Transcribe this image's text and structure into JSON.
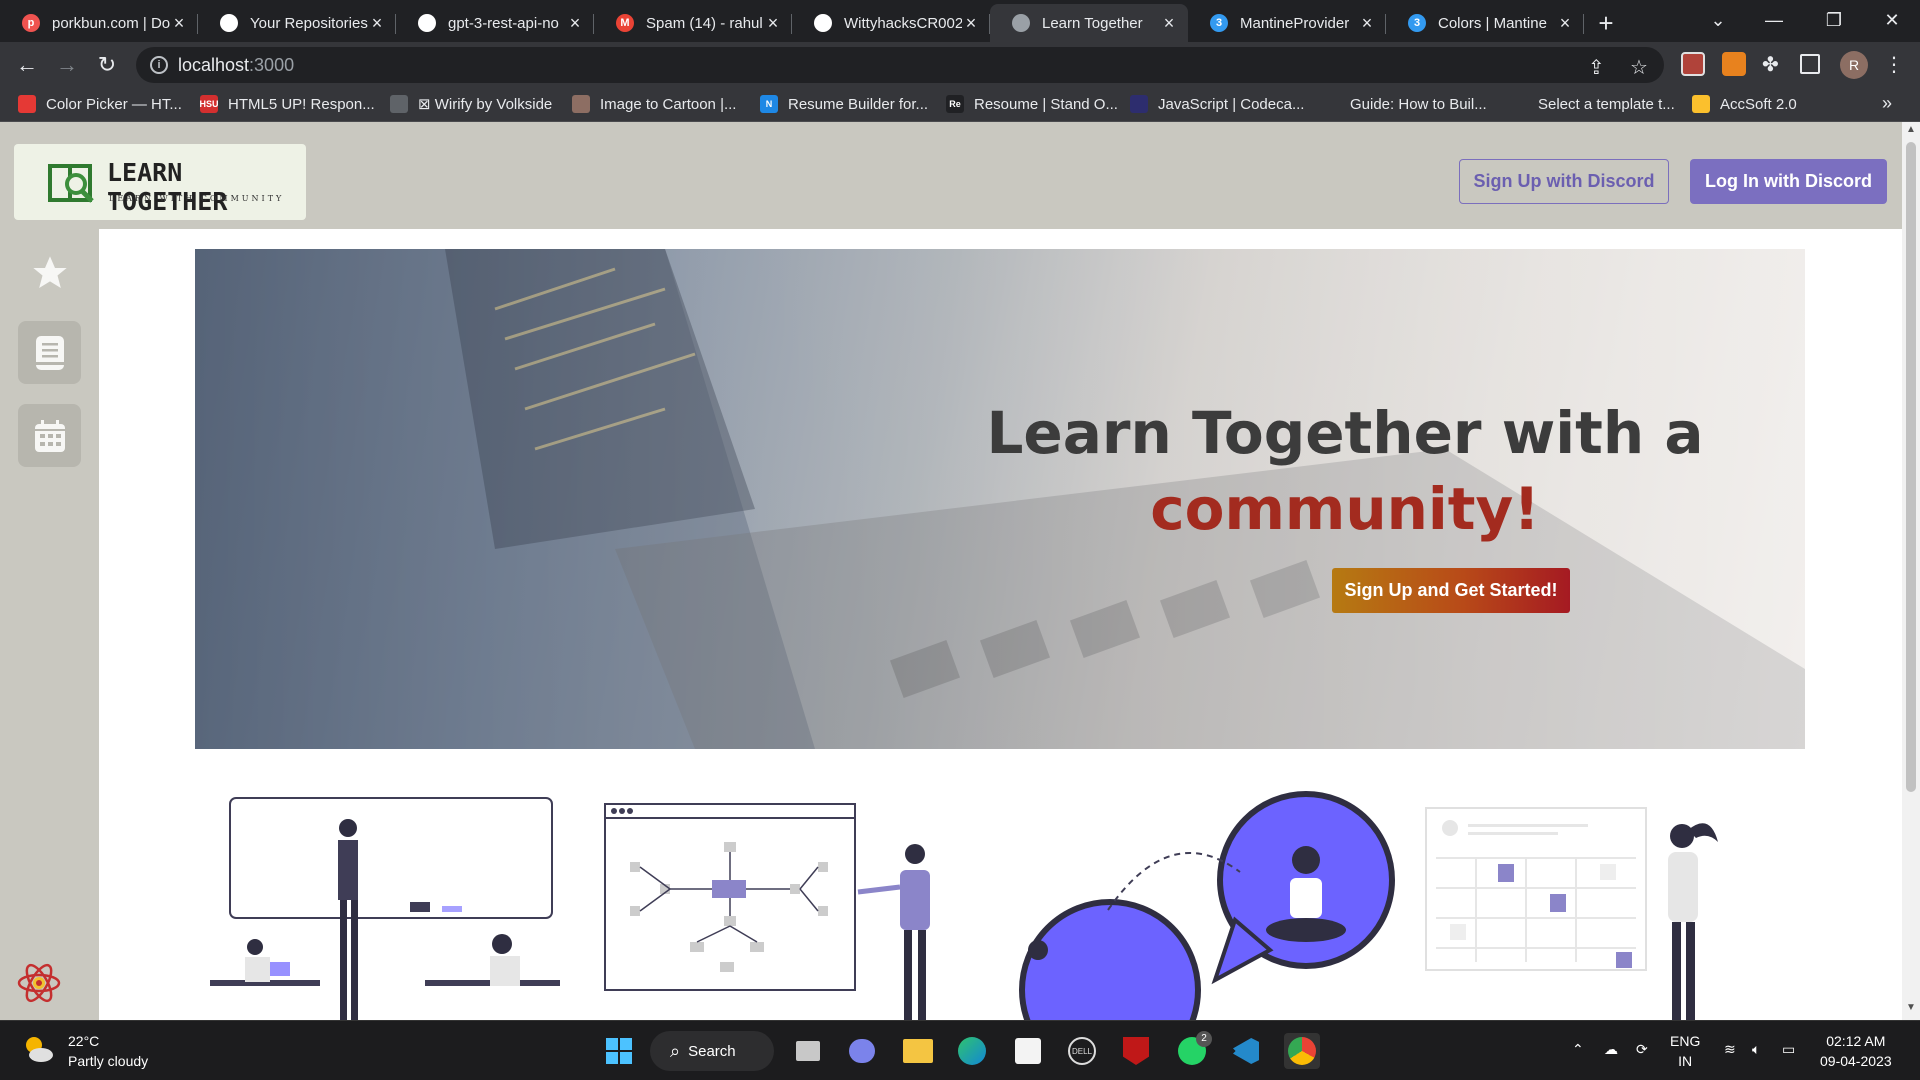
{
  "browser": {
    "tabs": [
      {
        "title": "porkbun.com | Do",
        "icon_color": "#ef5350",
        "icon_text": "p"
      },
      {
        "title": "Your Repositories",
        "icon_color": "#ffffff",
        "icon_text": ""
      },
      {
        "title": "gpt-3-rest-api-no",
        "icon_color": "#ffffff",
        "icon_text": ""
      },
      {
        "title": "Spam (14) - rahul",
        "icon_color": "#ea4335",
        "icon_text": "M"
      },
      {
        "title": "WittyhacksCR002",
        "icon_color": "#ffffff",
        "icon_text": ""
      },
      {
        "title": "Learn Together",
        "icon_color": "#9aa0a6",
        "icon_text": ""
      },
      {
        "title": "MantineProvider",
        "icon_color": "#339af0",
        "icon_text": "3"
      },
      {
        "title": "Colors | Mantine",
        "icon_color": "#339af0",
        "icon_text": "3"
      }
    ],
    "active_tab": 5,
    "url_host": "localhost",
    "url_port": ":3000",
    "profile_initial": "R",
    "bookmarks": [
      {
        "label": "Color Picker — HT...",
        "icon_color": "#e53935",
        "icon_text": ""
      },
      {
        "label": "HTML5 UP! Respon...",
        "icon_color": "#d32f2f",
        "icon_text": "HSU"
      },
      {
        "label": "⊠ Wirify by Volkside",
        "icon_color": "#5f6368",
        "icon_text": ""
      },
      {
        "label": "Image to Cartoon |...",
        "icon_color": "#8d6e63",
        "icon_text": ""
      },
      {
        "label": "Resume Builder for...",
        "icon_color": "#1e88e5",
        "icon_text": "N"
      },
      {
        "label": "Resoume | Stand O...",
        "icon_color": "#202124",
        "icon_text": "Re"
      },
      {
        "label": "JavaScript | Codeca...",
        "icon_color": "#2d2d6e",
        "icon_text": ""
      },
      {
        "label": "Guide: How to Buil...",
        "icon_color": "#35363a",
        "icon_text": ""
      },
      {
        "label": "Select a template t...",
        "icon_color": "#35363a",
        "icon_text": ""
      },
      {
        "label": "AccSoft 2.0",
        "icon_color": "#fbc02d",
        "icon_text": ""
      }
    ]
  },
  "site": {
    "logo_title": "LEARN TOGETHER",
    "logo_subtitle": "LEARN WITH COMMUNITY",
    "signup_button": "Sign Up with Discord",
    "login_button": "Log In with Discord",
    "sidebar": [
      "star-icon",
      "book-icon",
      "calendar-icon"
    ],
    "hero_line1": "Learn Together with a",
    "hero_line2": "community!",
    "hero_cta": "Sign Up and Get Started!",
    "colors": {
      "header_bg": "#c9c8c0",
      "accent": "#7b6fc0",
      "highlight": "#a32b1f"
    }
  },
  "taskbar": {
    "temperature": "22°C",
    "weather": "Partly cloudy",
    "search_label": "Search",
    "whatsapp_badge": "2",
    "lang_top": "ENG",
    "lang_bottom": "IN",
    "time": "02:12 AM",
    "date": "09-04-2023"
  }
}
